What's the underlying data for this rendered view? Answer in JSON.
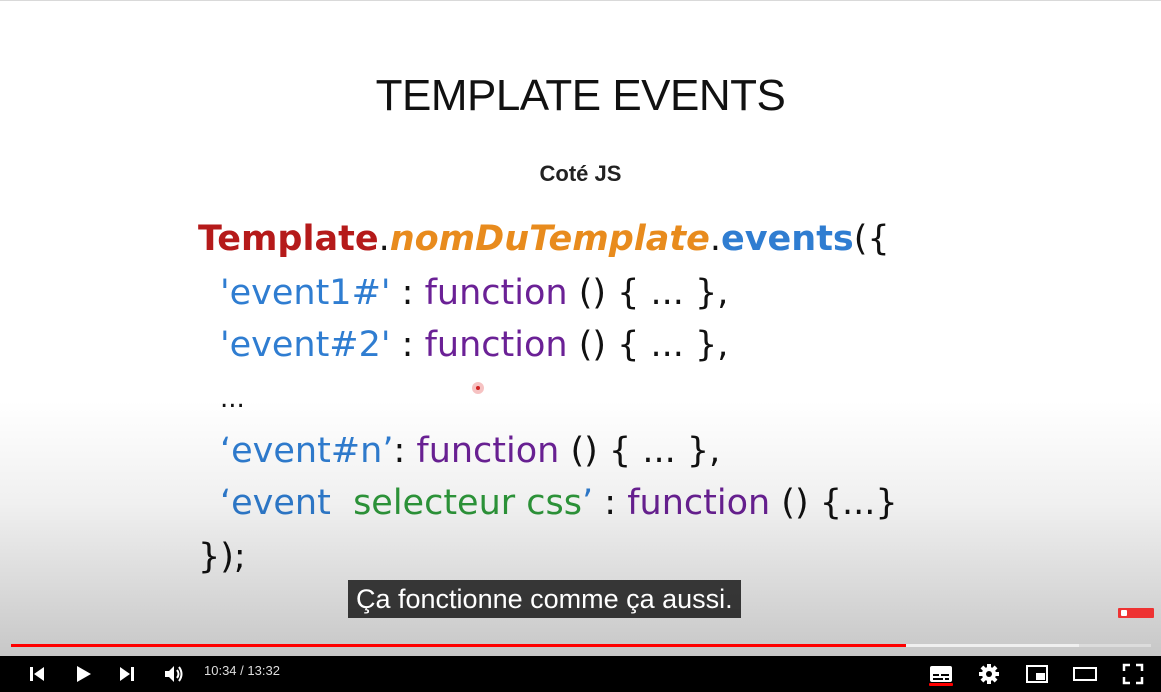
{
  "slide": {
    "title": "TEMPLATE EVENTS",
    "subtitle": "Coté JS",
    "code": {
      "l1_template": "Template",
      "l1_dot1": ".",
      "l1_name": "nomDuTemplate",
      "l1_dot2": ".",
      "l1_events": "events",
      "l1_open": "({",
      "l2_key": "'event1#'",
      "l2_colon": " : ",
      "l2_func": "function",
      "l2_rest": " () { ... },",
      "l3_key": "'event#2'",
      "l3_colon": " : ",
      "l3_func": "function",
      "l3_rest": " () { ... },",
      "l4": "...",
      "l5_key": "‘event#n’",
      "l5_colon": ": ",
      "l5_func": "function",
      "l5_rest": " () { ... },",
      "l6_open": "‘event  ",
      "l6_sel": "selecteur css",
      "l6_close": "’",
      "l6_colon": " : ",
      "l6_func": "function",
      "l6_rest": " () {...}",
      "l7": "});"
    }
  },
  "caption": "Ça fonctionne comme ça aussi.",
  "player": {
    "current_time": "10:34",
    "separator": " / ",
    "duration": "13:32",
    "progress_played": 0.785,
    "progress_buffered": 0.937,
    "icons": [
      "previous-icon",
      "play-icon",
      "next-icon",
      "volume-icon",
      "subtitles-icon",
      "settings-icon",
      "miniplayer-icon",
      "theater-mode-icon",
      "fullscreen-icon"
    ],
    "accent_color": "#ff0000"
  }
}
